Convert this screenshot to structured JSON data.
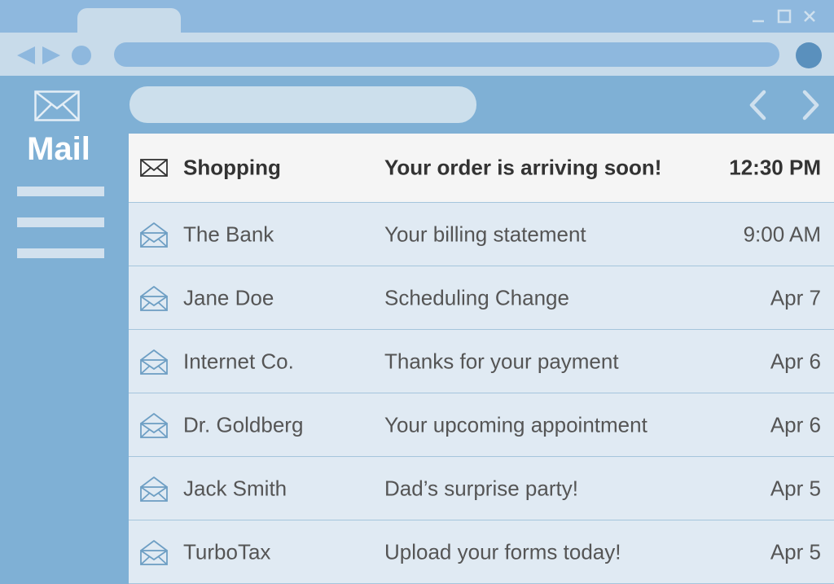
{
  "sidebar": {
    "title": "Mail"
  },
  "messages": [
    {
      "sender": "Shopping",
      "subject": "Your order is arriving soon!",
      "time": "12:30 PM",
      "unread": true
    },
    {
      "sender": "The Bank",
      "subject": "Your billing statement",
      "time": "9:00 AM",
      "unread": false
    },
    {
      "sender": "Jane Doe",
      "subject": "Scheduling Change",
      "time": "Apr 7",
      "unread": false
    },
    {
      "sender": "Internet Co.",
      "subject": "Thanks for your payment",
      "time": "Apr 6",
      "unread": false
    },
    {
      "sender": "Dr. Goldberg",
      "subject": "Your upcoming appointment",
      "time": "Apr 6",
      "unread": false
    },
    {
      "sender": "Jack Smith",
      "subject": "Dad’s surprise party!",
      "time": "Apr 5",
      "unread": false
    },
    {
      "sender": "TurboTax",
      "subject": "Upload your forms today!",
      "time": "Apr 5",
      "unread": false
    }
  ],
  "icons": {
    "minimize": "minimize-icon",
    "maximize": "maximize-icon",
    "close": "close-icon",
    "back": "back-arrow-icon",
    "forward": "forward-arrow-icon",
    "mail": "envelope-icon",
    "unread": "closed-envelope-icon",
    "read": "open-envelope-icon",
    "prev_page": "chevron-left-icon",
    "next_page": "chevron-right-icon"
  },
  "colors": {
    "background": "#7fb0d5",
    "titlebar": "#8eb8de",
    "toolbar": "#c8dbea",
    "row_read": "#e0eaf3",
    "row_unread": "#f5f5f5",
    "accent": "#5a90bd"
  }
}
